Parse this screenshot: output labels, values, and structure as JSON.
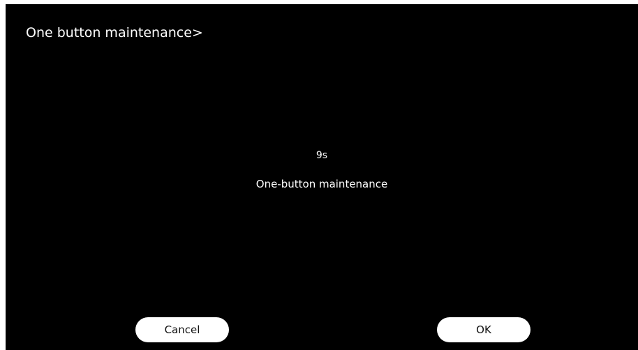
{
  "header": {
    "title": "One button maintenance>"
  },
  "dialog": {
    "countdown": "9s",
    "message": "One-button maintenance"
  },
  "buttons": {
    "cancel_label": "Cancel",
    "ok_label": "OK"
  },
  "colors": {
    "background": "#000000",
    "text": "#ffffff",
    "button_background": "#ffffff",
    "button_text": "#111111"
  }
}
